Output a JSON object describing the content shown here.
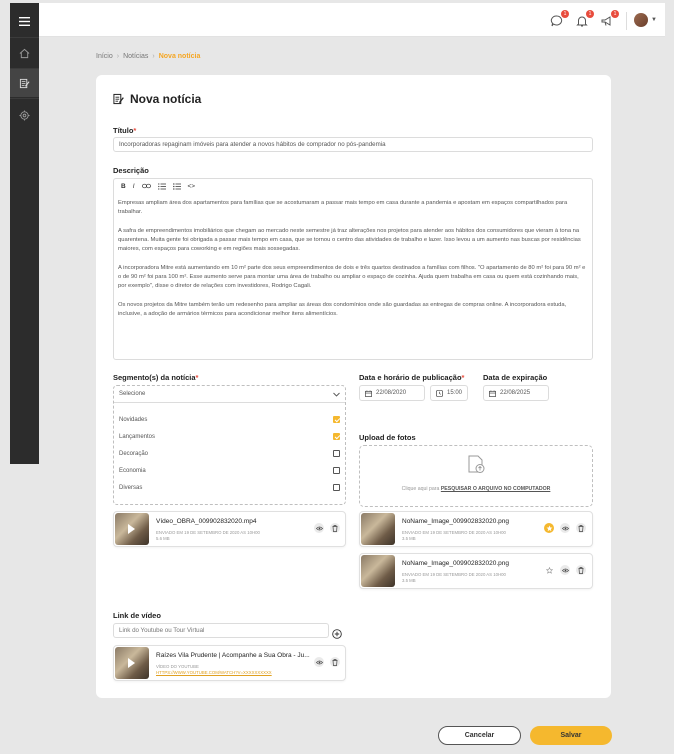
{
  "breadcrumb": [
    "Início",
    "Notícias",
    "Nova notícia"
  ],
  "topbar": {
    "badges": [
      "1",
      "1",
      "1"
    ],
    "icons": [
      "chat-icon",
      "bell-icon",
      "megaphone-icon"
    ]
  },
  "page": {
    "title": "Nova notícia"
  },
  "form": {
    "titulo_label": "Título",
    "titulo_value": "Incorporadoras repaginam imóveis para atender a novos hábitos de comprador no pós-pandemia",
    "descricao_label": "Descrição",
    "toolbar": [
      "B",
      "I",
      "⛓",
      "☰",
      "☰",
      "<>"
    ],
    "descricao_paragraphs": [
      "Empresas ampliam área dos apartamentos para famílias que se acostumaram a passar mais tempo em casa durante a pandemia e apostam em espaços compartilhados para trabalhar.",
      "A safra de empreendimentos imobiliários que chegam ao mercado neste semestre já traz alterações nos projetos para atender aos hábitos dos consumidores que vieram à tona na quarentena. Muita gente foi obrigada a passar mais tempo em casa, que se tornou o centro das atividades de trabalho e lazer. Isso levou a um aumento nas buscas por residências maiores, com espaços para coworking e em regiões mais sossegadas.",
      "A incorporadora Mitre está aumentando em 10 m² parte dos seus empreendimentos de dois e três quartos destinados a famílias com filhos. \"O apartamento de 80 m² foi para 90 m² e o de 90 m² foi para 100 m². Esse aumento serve para montar uma área de trabalho ou ampliar o espaço de cozinha. Ajuda quem trabalha em casa ou quem está cozinhando mais, por exemplo\", disse o diretor de relações com investidores, Rodrigo Cagali.",
      "Os novos projetos da Mitre também terão um redesenho para ampliar as áreas dos condomínios onde são guardadas as entregas de compras online. A incorporadora estuda, inclusive, a adoção de armários térmicos para acondicionar melhor itens alimentícios."
    ],
    "segmento_label": "Segmento(s) da notícia",
    "segmento_select": "Selecione",
    "segmentos": [
      {
        "label": "Novidades",
        "checked": true
      },
      {
        "label": "Lançamentos",
        "checked": true
      },
      {
        "label": "Decoração",
        "checked": false
      },
      {
        "label": "Economia",
        "checked": false
      },
      {
        "label": "Diversas",
        "checked": false
      }
    ],
    "data_pub_label": "Data e horário de publicação",
    "data_pub_value": "22/08/2020",
    "hora_pub_value": "15:00",
    "data_exp_label": "Data de expiração",
    "data_exp_value": "22/08/2025",
    "upload_label": "Upload de fotos",
    "upload_text": "Clique aqui para",
    "upload_link": "PESQUISAR O ARQUIVO NO COMPUTADOR",
    "link_video_label": "Link de vídeo",
    "link_video_placeholder": "Link do Youtube ou Tour Virtual"
  },
  "video_file": {
    "name": "Vídeo_OBRA_009902832020.mp4",
    "meta1": "ENVIADO EM 19 DE SETEMBRO DE 2020 AS 10H00",
    "meta2": "5.6 MB"
  },
  "photos": [
    {
      "name": "NoName_Image_009902832020.png",
      "meta1": "ENVIADO EM 19 DE SETEMBRO DE 2020 AS 10H00",
      "meta2": "3.5 MB",
      "featured": true
    },
    {
      "name": "NoName_Image_009902832020.png",
      "meta1": "ENVIADO EM 19 DE SETEMBRO DE 2020 AS 10H00",
      "meta2": "3.5 MB",
      "featured": false
    }
  ],
  "video_link": {
    "name": "Raízes Vila Prudente | Acompanhe a Sua Obra - Ju...",
    "meta1": "VÍDEO DO YOUTUBE",
    "url": "HTTPS://WWW.YOUTUBE.COM/WATCH?V=XXXXXXXXXX"
  },
  "buttons": {
    "cancel": "Cancelar",
    "save": "Salvar"
  },
  "colors": {
    "accent": "#f5b82e",
    "sidebar": "#2c2c2c",
    "badge": "#e84c3d"
  }
}
